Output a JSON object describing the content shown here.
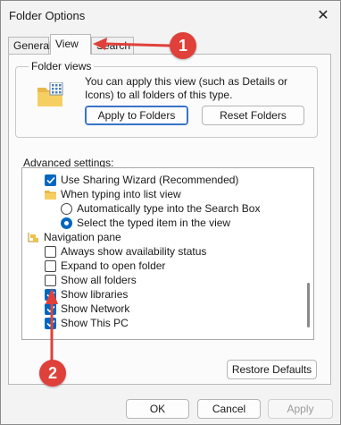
{
  "window": {
    "title": "Folder Options",
    "close_glyph": "✕"
  },
  "tabs": [
    {
      "label": "General"
    },
    {
      "label": "View"
    },
    {
      "label": "Search"
    }
  ],
  "folder_views": {
    "label": "Folder views",
    "description": "You can apply this view (such as Details or Icons) to all folders of this type.",
    "apply_button": "Apply to Folders",
    "reset_button": "Reset Folders"
  },
  "advanced": {
    "label": "Advanced settings:",
    "items": [
      {
        "type": "checkbox",
        "checked": true,
        "label": "Use Sharing Wizard (Recommended)"
      },
      {
        "type": "folder",
        "label": "When typing into list view"
      },
      {
        "type": "radio",
        "checked": false,
        "label": "Automatically type into the Search Box"
      },
      {
        "type": "radio",
        "checked": true,
        "label": "Select the typed item in the view"
      },
      {
        "type": "navfolder",
        "label": "Navigation pane"
      },
      {
        "type": "checkbox",
        "checked": false,
        "label": "Always show availability status"
      },
      {
        "type": "checkbox",
        "checked": false,
        "label": "Expand to open folder"
      },
      {
        "type": "checkbox",
        "checked": false,
        "label": "Show all folders"
      },
      {
        "type": "checkbox",
        "checked": true,
        "label": "Show libraries"
      },
      {
        "type": "checkbox",
        "checked": true,
        "label": "Show Network"
      },
      {
        "type": "checkbox",
        "checked": true,
        "label": "Show This PC"
      }
    ]
  },
  "buttons": {
    "restore": "Restore Defaults",
    "ok": "OK",
    "cancel": "Cancel",
    "apply": "Apply"
  },
  "annotations": {
    "one": "1",
    "two": "2",
    "color": "#e0403a"
  },
  "colors": {
    "accent": "#0067c0"
  }
}
